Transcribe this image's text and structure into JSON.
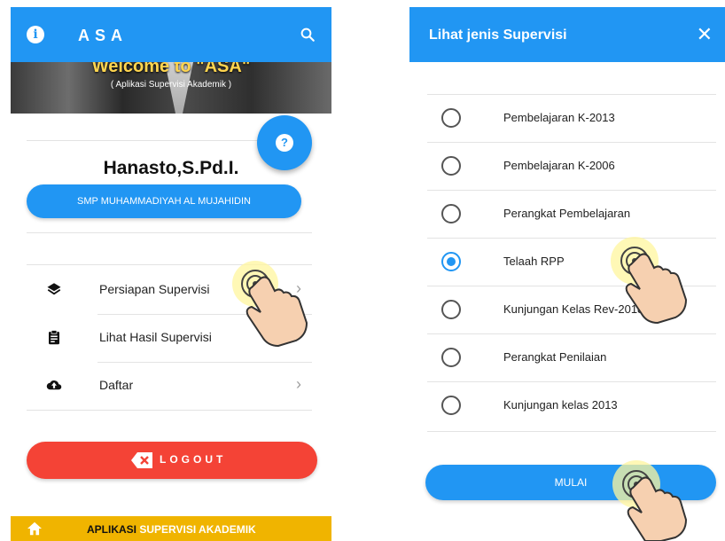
{
  "left_screen": {
    "app_title": "ASA",
    "icons": {
      "info": "info-icon",
      "search": "search-icon",
      "help": "help-icon",
      "home": "home-icon"
    },
    "banner": {
      "welcome": "Welcome to \"ASA\"",
      "subtitle": "( Aplikasi Supervisi Akademik )"
    },
    "user_name": "Hanasto,S.Pd.I.",
    "school_button": "SMP MUHAMMADIYAH AL MUJAHIDIN",
    "menu": [
      {
        "label": "Persiapan Supervisi",
        "icon": "layers-icon"
      },
      {
        "label": "Lihat Hasil Supervisi",
        "icon": "clipboard-icon"
      },
      {
        "label": "Daftar",
        "icon": "cloud-upload-icon"
      }
    ],
    "logout_label": "LOGOUT",
    "bottom_bar": {
      "part1": "APLIKASI",
      "part2": "SUPERVISI AKADEMIK"
    }
  },
  "right_screen": {
    "dialog_title": "Lihat jenis Supervisi",
    "close_symbol": "✕",
    "options": [
      {
        "label": "Pembelajaran K-2013",
        "selected": false
      },
      {
        "label": "Pembelajaran K-2006",
        "selected": false
      },
      {
        "label": "Perangkat Pembelajaran",
        "selected": false
      },
      {
        "label": "Telaah RPP",
        "selected": true
      },
      {
        "label": "Kunjungan Kelas Rev-2018",
        "selected": false
      },
      {
        "label": "Perangkat Penilaian",
        "selected": false
      },
      {
        "label": "Kunjungan kelas 2013",
        "selected": false
      }
    ],
    "start_button": "MULAI"
  },
  "colors": {
    "primary": "#2196f3",
    "logout": "#f44336",
    "bottom_bar": "#f0b400"
  }
}
